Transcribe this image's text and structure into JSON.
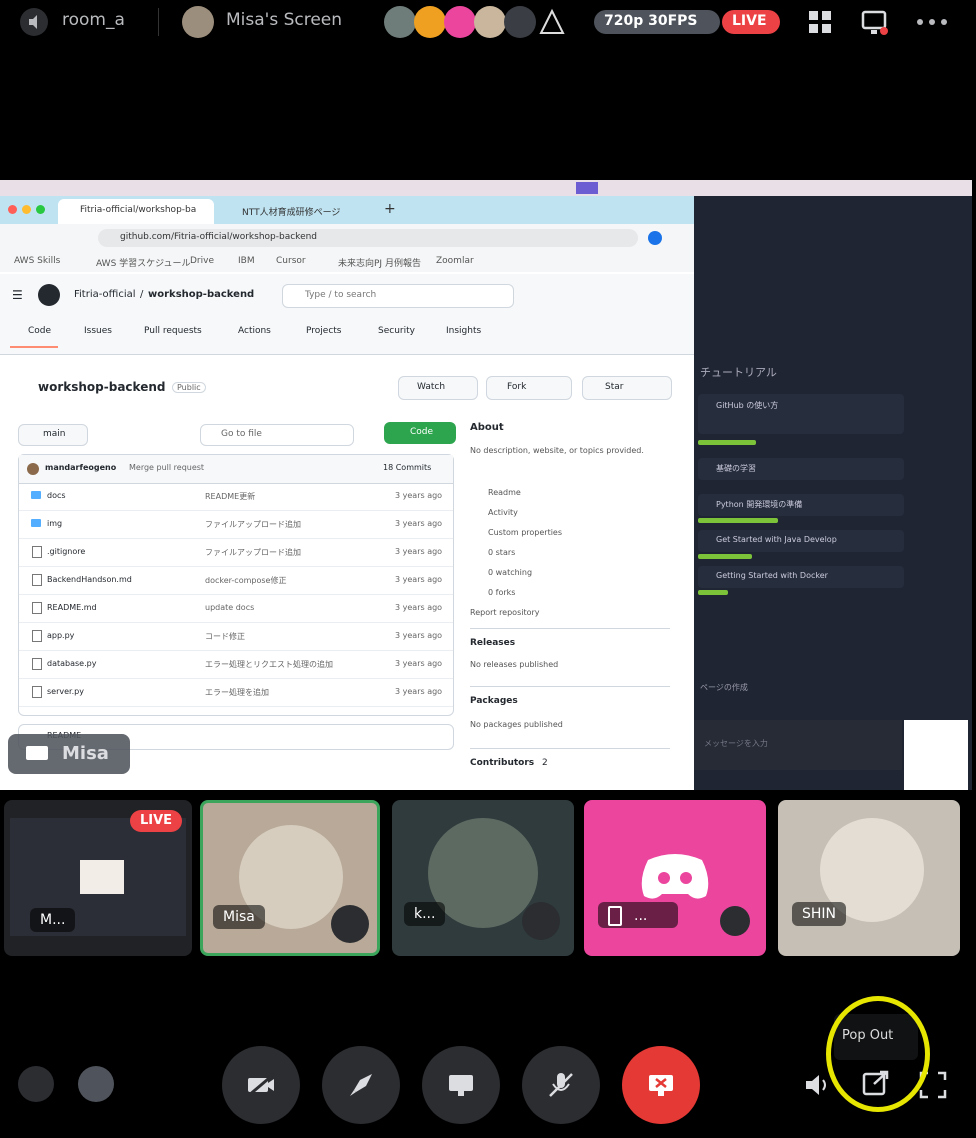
{
  "topbar": {
    "room_name": "room_a",
    "stream_title": "Misa's Screen",
    "stream_quality": "720p 30FPS",
    "live_badge": "LIVE"
  },
  "browser": {
    "tab1_label": "Fitria-official/workshop-ba",
    "tab2_label": "NTT人材育成研修ページ",
    "url": "github.com/Fitria-official/workshop-backend",
    "bookmarks": [
      "AWS Skills",
      "AWS 学習スケジュール",
      "Drive",
      "IBM",
      "Cursor",
      "未来志向PJ 月例報告",
      "Zoomlar"
    ],
    "gh": {
      "owner": "Fitria-official",
      "repo": "workshop-backend",
      "search_placeholder": "Type / to search",
      "nav": [
        "Code",
        "Issues",
        "Pull requests",
        "Actions",
        "Projects",
        "Security",
        "Insights"
      ],
      "repo_title": "workshop-backend",
      "visibility": "Public",
      "watch": "Watch",
      "fork": "Fork",
      "star": "Star",
      "branch": "main",
      "goto_file": "Go to file",
      "code_button": "Code",
      "commit_author": "mandarfeogeno",
      "commit_msg": "Merge pull request",
      "commit_count": "18 Commits",
      "files": [
        {
          "name": "docs",
          "msg": "README更新",
          "time": "3 years ago",
          "type": "folder"
        },
        {
          "name": "img",
          "msg": "ファイルアップロード追加",
          "time": "3 years ago",
          "type": "folder"
        },
        {
          "name": ".gitignore",
          "msg": "ファイルアップロード追加",
          "time": "3 years ago",
          "type": "file"
        },
        {
          "name": "BackendHandson.md",
          "msg": "docker-compose修正",
          "time": "3 years ago",
          "type": "file"
        },
        {
          "name": "README.md",
          "msg": "update docs",
          "time": "3 years ago",
          "type": "file"
        },
        {
          "name": "app.py",
          "msg": "コード修正",
          "time": "3 years ago",
          "type": "file"
        },
        {
          "name": "database.py",
          "msg": "エラー処理とリクエスト処理の追加",
          "time": "3 years ago",
          "type": "file"
        },
        {
          "name": "server.py",
          "msg": "エラー処理を追加",
          "time": "3 years ago",
          "type": "file"
        }
      ],
      "readme": "README",
      "about": {
        "title": "About",
        "description": "No description, website, or topics provided.",
        "items": [
          "Readme",
          "Activity",
          "Custom properties",
          "0 stars",
          "0 watching",
          "0 forks"
        ],
        "report": "Report repository",
        "releases_title": "Releases",
        "releases_text": "No releases published",
        "packages_title": "Packages",
        "packages_text": "No packages published",
        "contributors_title": "Contributors",
        "contributors_count": "2"
      }
    }
  },
  "right_pane": {
    "heading": "チュートリアル",
    "items": [
      "GitHub の使い方",
      "基礎の学習",
      "Python 開発環境の準備",
      "Get Started with Java Develop",
      "Getting Started with Docker"
    ],
    "footer_text": "ページの作成",
    "input_hint": "メッセージを入力"
  },
  "presenter_label": "Misa",
  "participants": [
    {
      "label": "M...",
      "badge": "LIVE",
      "bg": "#202225"
    },
    {
      "label": "Misa",
      "bg": "#b8a998",
      "border": "#3ba55c"
    },
    {
      "label": "k...",
      "bg": "#2f3b3c"
    },
    {
      "label": "...",
      "bg": "#eb459e"
    },
    {
      "label": "SHIN",
      "bg": "#c5bfb5"
    }
  ],
  "tooltip": "Pop Out",
  "colors": {
    "live": "#ed4245",
    "green": "#3ba55c",
    "discord_pink": "#eb459e",
    "highlight": "#e6e600",
    "end_call": "#e53935"
  },
  "icons": [
    "speaker-icon",
    "grid-icon",
    "screen-icon",
    "more-icon",
    "camera-off-icon",
    "rocket-icon",
    "screen-share-icon",
    "mic-off-icon",
    "stop-stream-icon",
    "volume-icon",
    "pop-out-icon",
    "fullscreen-icon"
  ]
}
